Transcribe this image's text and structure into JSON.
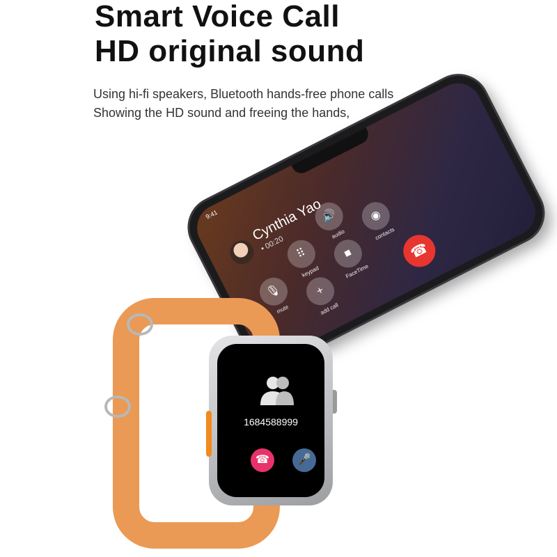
{
  "headline": {
    "line1": "Smart Voice Call",
    "line2": "HD original sound"
  },
  "subtitle": {
    "line1": "Using hi-fi speakers, Bluetooth hands-free phone calls",
    "line2": "Showing the HD sound and freeing the hands,"
  },
  "phone": {
    "status_time": "9:41",
    "caller_name": "Cynthia Yao",
    "call_duration": "00:20",
    "controls": [
      {
        "label": "mute",
        "icon": "mic-off-icon"
      },
      {
        "label": "keypad",
        "icon": "keypad-icon"
      },
      {
        "label": "audio",
        "icon": "speaker-icon"
      },
      {
        "label": "add call",
        "icon": "plus-icon"
      },
      {
        "label": "FaceTime",
        "icon": "video-icon"
      },
      {
        "label": "contacts",
        "icon": "contact-icon"
      }
    ],
    "end_call_icon": "hangup-icon"
  },
  "watch": {
    "number": "1684588999",
    "end_call_icon": "hangup-icon",
    "mic_icon": "mic-icon",
    "band_color": "#ea9a55"
  }
}
